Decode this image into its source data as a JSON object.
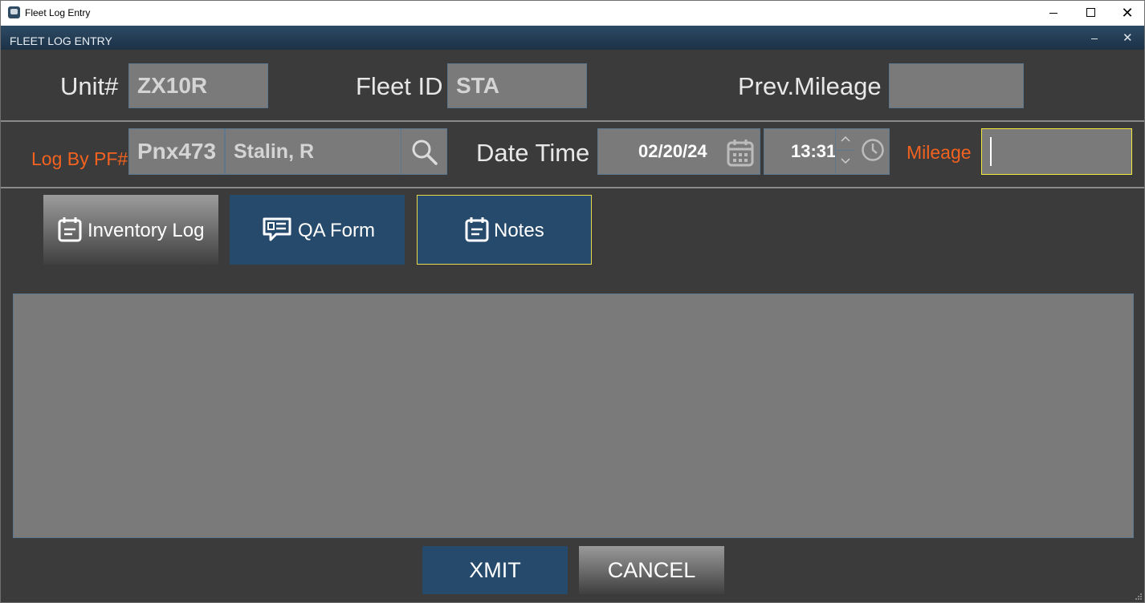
{
  "window": {
    "title": "Fleet Log Entry"
  },
  "app_header": {
    "title": "FLEET LOG ENTRY"
  },
  "row1": {
    "unit_label": "Unit#",
    "unit_value": "ZX10R",
    "fleet_label": "Fleet ID",
    "fleet_value": "STA",
    "prev_mileage_label": "Prev.Mileage",
    "prev_mileage_value": ""
  },
  "row2": {
    "log_by_label": "Log By PF#",
    "pf_value": "Pnx473",
    "name_value": "Stalin, R",
    "datetime_label": "Date Time",
    "date_value": "02/20/24",
    "time_value": "13:31",
    "mileage_label": "Mileage",
    "mileage_value": ""
  },
  "tabs": [
    {
      "label": "Inventory Log",
      "icon": "calendar-note-icon"
    },
    {
      "label": "QA Form",
      "icon": "qa-chat-icon"
    },
    {
      "label": "Notes",
      "icon": "calendar-note-icon"
    }
  ],
  "notes": {
    "text": ""
  },
  "actions": {
    "xmit": "XMIT",
    "cancel": "CANCEL"
  },
  "colors": {
    "background": "#3b3b3b",
    "field": "#7a7a7a",
    "accent_blue": "#264a6b",
    "required_label": "#f4621f",
    "focus_border": "#f5e93a"
  }
}
